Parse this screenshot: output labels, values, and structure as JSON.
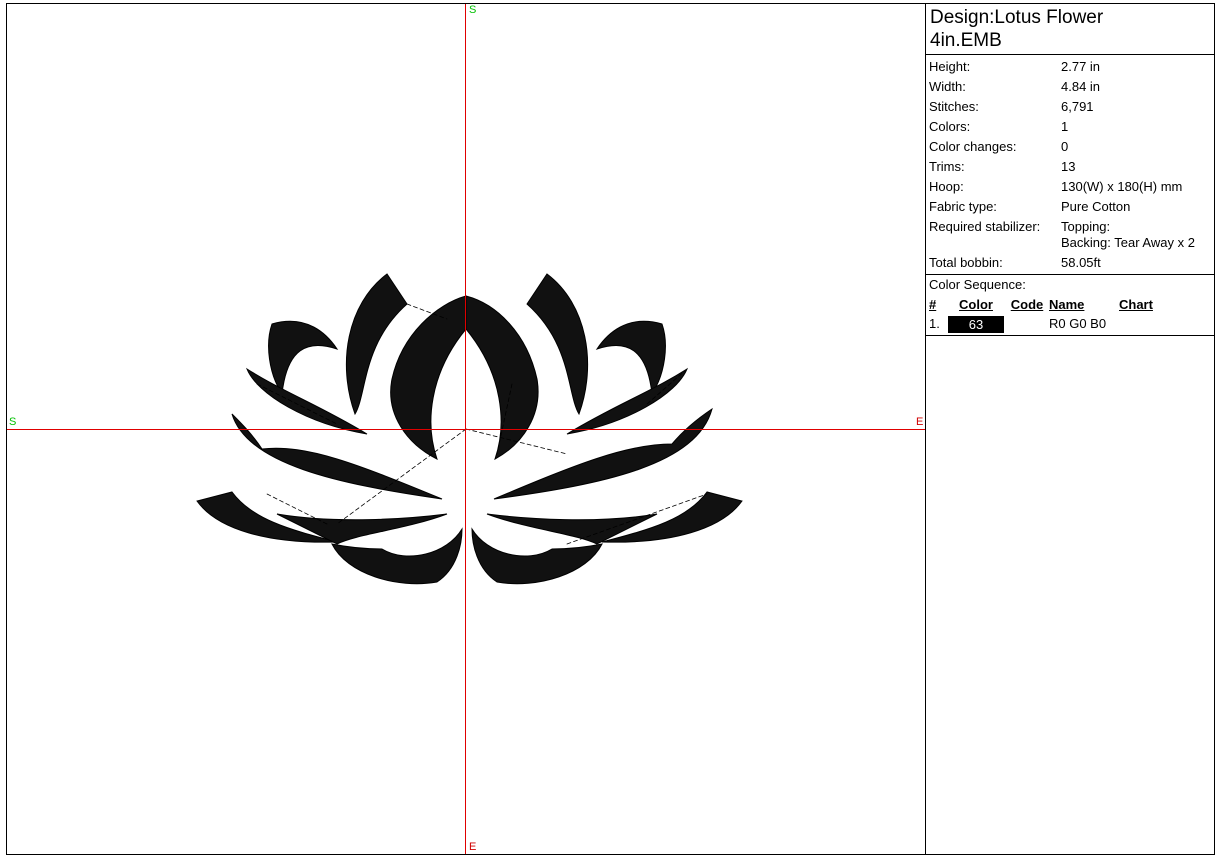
{
  "canvas": {
    "markers": {
      "top": "S",
      "bottom": "E",
      "left": "S",
      "right": "E"
    },
    "axis_color": "#e00000",
    "stitch_color": "#000000"
  },
  "design": {
    "title_line1": "Design:Lotus Flower",
    "title_line2": "4in.EMB"
  },
  "info": [
    {
      "label": "Height:",
      "value": "2.77 in"
    },
    {
      "label": "Width:",
      "value": "4.84 in"
    },
    {
      "label": "Stitches:",
      "value": "6,791"
    },
    {
      "label": "Colors:",
      "value": "1"
    },
    {
      "label": "Color changes:",
      "value": "0"
    },
    {
      "label": "Trims:",
      "value": "13"
    },
    {
      "label": "Hoop:",
      "value": "130(W) x 180(H) mm"
    },
    {
      "label": "Fabric type:",
      "value": "Pure Cotton"
    }
  ],
  "stabilizer": {
    "label": "Required stabilizer:",
    "topping": "Topping:",
    "backing": "Backing: Tear Away x 2"
  },
  "bobbin": {
    "label": "Total bobbin:",
    "value": "58.05ft"
  },
  "color_sequence": {
    "title": "Color Sequence:",
    "headers": {
      "num": "#",
      "color": "Color",
      "code": "Code",
      "name": "Name",
      "chart": "Chart"
    },
    "rows": [
      {
        "num": "1.",
        "color_label": "63",
        "color_hex": "#000000",
        "code": "",
        "name": "R0 G0 B0",
        "chart": ""
      }
    ]
  }
}
